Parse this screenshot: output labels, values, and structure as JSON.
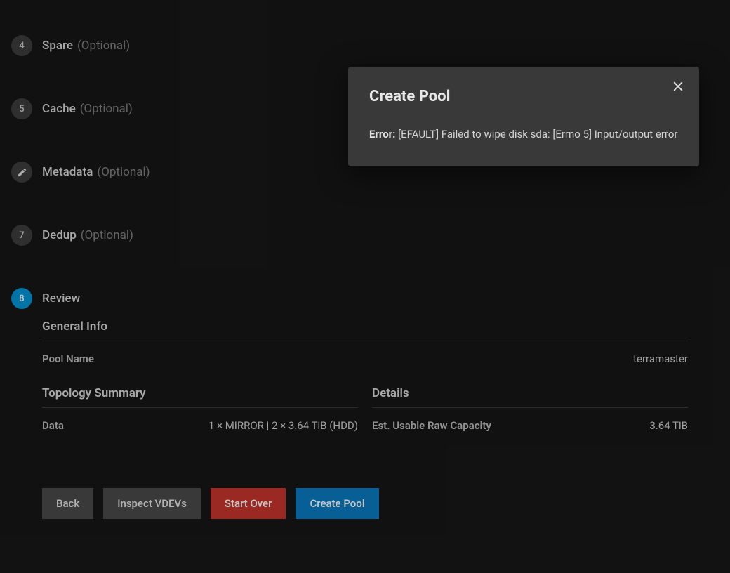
{
  "steps": [
    {
      "num": "4",
      "label": "Spare",
      "optional": "(Optional)",
      "icon": null,
      "active": false
    },
    {
      "num": "5",
      "label": "Cache",
      "optional": "(Optional)",
      "icon": null,
      "active": false
    },
    {
      "num": "",
      "label": "Metadata",
      "optional": "(Optional)",
      "icon": "pencil",
      "active": false
    },
    {
      "num": "7",
      "label": "Dedup",
      "optional": "(Optional)",
      "icon": null,
      "active": false
    },
    {
      "num": "8",
      "label": "Review",
      "optional": "",
      "icon": null,
      "active": true
    }
  ],
  "general_info": {
    "header": "General Info",
    "pool_name_key": "Pool Name",
    "pool_name_val": "terramaster"
  },
  "topology": {
    "header": "Topology Summary",
    "data_key": "Data",
    "data_val": "1 × MIRROR | 2 × 3.64 TiB (HDD)"
  },
  "details": {
    "header": "Details",
    "capacity_key": "Est. Usable Raw Capacity",
    "capacity_val": "3.64 TiB"
  },
  "buttons": {
    "back": "Back",
    "inspect": "Inspect VDEVs",
    "start_over": "Start Over",
    "create": "Create Pool"
  },
  "modal": {
    "title": "Create Pool",
    "error_label": "Error:",
    "error_msg": "[EFAULT] Failed to wipe disk sda: [Errno 5] Input/output error"
  }
}
